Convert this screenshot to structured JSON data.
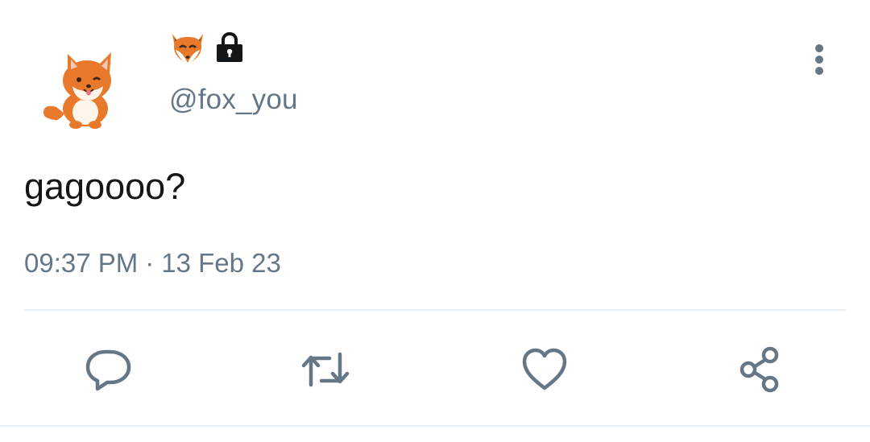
{
  "tweet": {
    "handle": "@fox_you",
    "text": "gagoooo?",
    "time": "09:37 PM",
    "separator": "·",
    "date": "13 Feb 23",
    "avatar_icon": "fox-dog-sticker-avatar",
    "name_emoji": "fox-face-emoji",
    "protected_icon": "lock-icon"
  },
  "actions": {
    "reply_icon": "comment-icon",
    "retweet_icon": "retweet-icon",
    "like_icon": "heart-icon",
    "share_icon": "share-icon",
    "more_icon": "more-vertical-icon"
  },
  "colors": {
    "text": "#14171a",
    "muted": "#657786",
    "divider": "#e6ecf0",
    "fox_orange": "#e8782a"
  }
}
